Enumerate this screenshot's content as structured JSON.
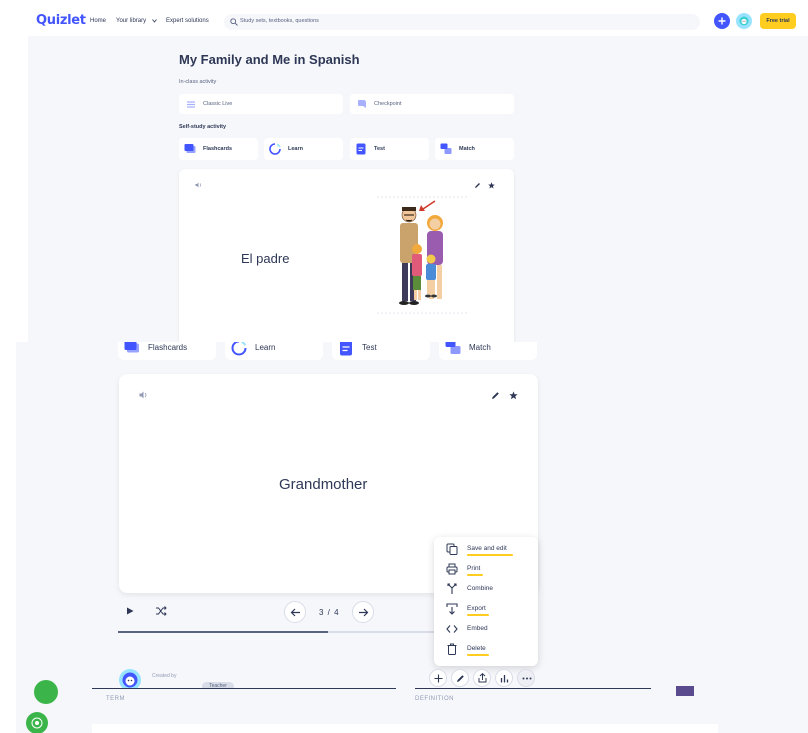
{
  "nav": {
    "logo": "Quizlet",
    "home": "Home",
    "library": "Your library",
    "expert": "Expert solutions",
    "search_placeholder": "Study sets, textbooks, questions",
    "free_trial": "Free trial"
  },
  "set": {
    "title": "My Family and Me in Spanish",
    "in_class_label": "In-class activity",
    "in_class": [
      "Classic Live",
      "Checkpoint"
    ],
    "self_study_label": "Self-study activity",
    "modes": [
      "Flashcards",
      "Learn",
      "Test",
      "Match"
    ]
  },
  "card_top": {
    "word": "El padre"
  },
  "card_bottom": {
    "word": "Grandmother",
    "counter": "3 / 4"
  },
  "menu": {
    "items": [
      {
        "label": "Save and edit",
        "icon": "copy-icon"
      },
      {
        "label": "Print",
        "icon": "printer-icon"
      },
      {
        "label": "Combine",
        "icon": "merge-icon"
      },
      {
        "label": "Export",
        "icon": "export-icon"
      },
      {
        "label": "Embed",
        "icon": "code-icon"
      },
      {
        "label": "Delete",
        "icon": "trash-icon"
      }
    ]
  },
  "creator": {
    "created_by": "Created by",
    "badge": "Teacher"
  },
  "table": {
    "term": "TERM",
    "definition": "DEFINITION"
  },
  "colors": {
    "brand": "#4255ff",
    "highlight": "#ffcd1f",
    "background": "#f6f7fb",
    "text": "#2e3856"
  }
}
